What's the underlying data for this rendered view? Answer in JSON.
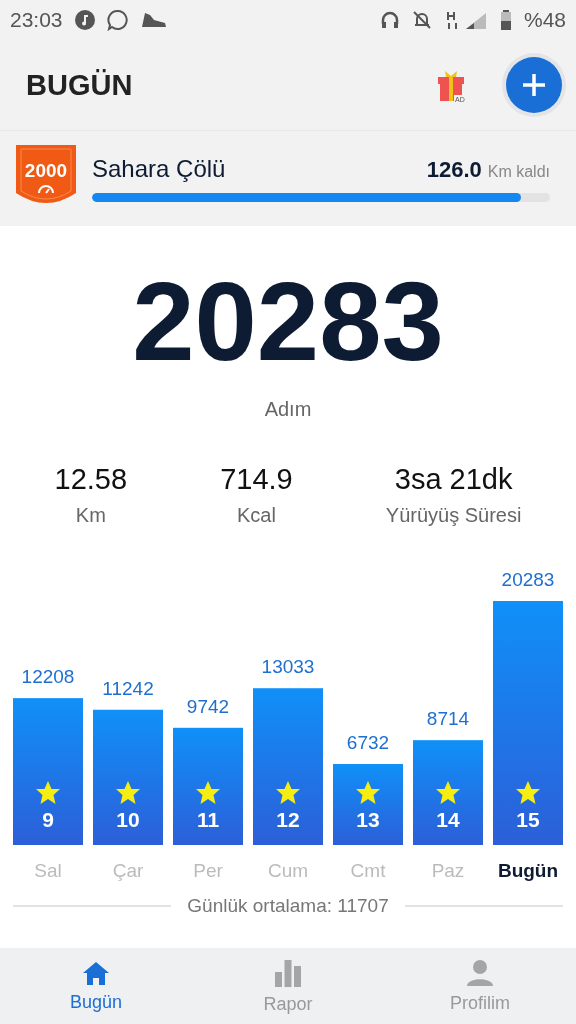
{
  "status_bar": {
    "time": "23:03",
    "battery": "%48"
  },
  "header": {
    "title": "BUGÜN",
    "gift_badge": "AD"
  },
  "challenge": {
    "badge": "2000",
    "name": "Sahara Çölü",
    "remaining": "126.0",
    "remaining_unit": "Km kaldı",
    "level": 0.937
  },
  "steps": {
    "value": "20283",
    "label": "Adım"
  },
  "stats": [
    {
      "value": "12.58",
      "label": "Km"
    },
    {
      "value": "714.9",
      "label": "Kcal"
    },
    {
      "value": "3sa 21dk",
      "label": "Yürüyüş Süresi"
    }
  ],
  "chart_data": {
    "type": "bar",
    "categories": [
      "Sal",
      "Çar",
      "Per",
      "Cum",
      "Cmt",
      "Paz",
      "Bugün"
    ],
    "values": [
      12208,
      11242,
      9742,
      13033,
      6732,
      8714,
      20283
    ],
    "data_labels": true
  },
  "days": [
    {
      "badge": "9",
      "selected": false
    },
    {
      "badge": "10",
      "selected": false
    },
    {
      "badge": "11",
      "selected": false
    },
    {
      "badge": "12",
      "selected": false
    },
    {
      "badge": "13",
      "selected": false
    },
    {
      "badge": "14",
      "selected": false
    },
    {
      "badge": "15",
      "selected": true
    }
  ],
  "average": "Günlük ortalama: 11707",
  "nav": [
    {
      "label": "Bugün",
      "selected": true
    },
    {
      "label": "Rapor",
      "selected": false
    },
    {
      "label": "Profilim",
      "selected": false
    }
  ]
}
